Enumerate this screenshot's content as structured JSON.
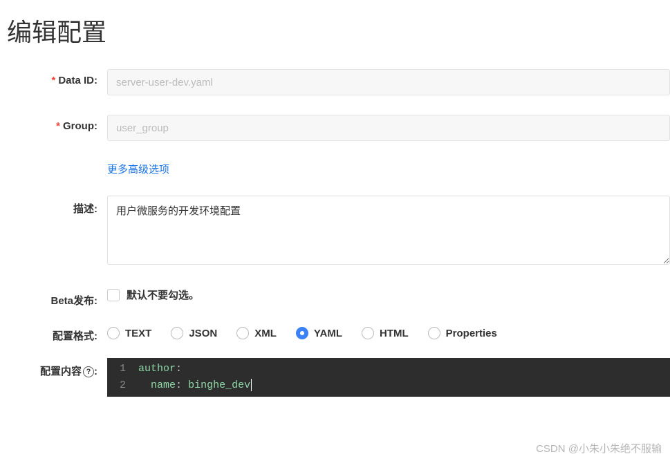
{
  "page_title": "编辑配置",
  "labels": {
    "data_id": "Data ID:",
    "group": "Group:",
    "advanced": "更多高级选项",
    "description": "描述:",
    "beta": "Beta发布:",
    "beta_checkbox": "默认不要勾选。",
    "format": "配置格式:",
    "content": "配置内容",
    "help_glyph": "?"
  },
  "fields": {
    "data_id_value": "server-user-dev.yaml",
    "group_value": "user_group",
    "description_value": "用户微服务的开发环境配置"
  },
  "format_options": {
    "text": "TEXT",
    "json": "JSON",
    "xml": "XML",
    "yaml": "YAML",
    "html": "HTML",
    "properties": "Properties",
    "selected": "yaml"
  },
  "code": {
    "line_numbers": [
      "1",
      "2"
    ],
    "line1_key": "author",
    "line1_colon": ":",
    "line2_indent": "  ",
    "line2_key": "name",
    "line2_colon": ": ",
    "line2_value": "binghe_dev"
  },
  "watermark": "CSDN @小朱小朱绝不服输"
}
